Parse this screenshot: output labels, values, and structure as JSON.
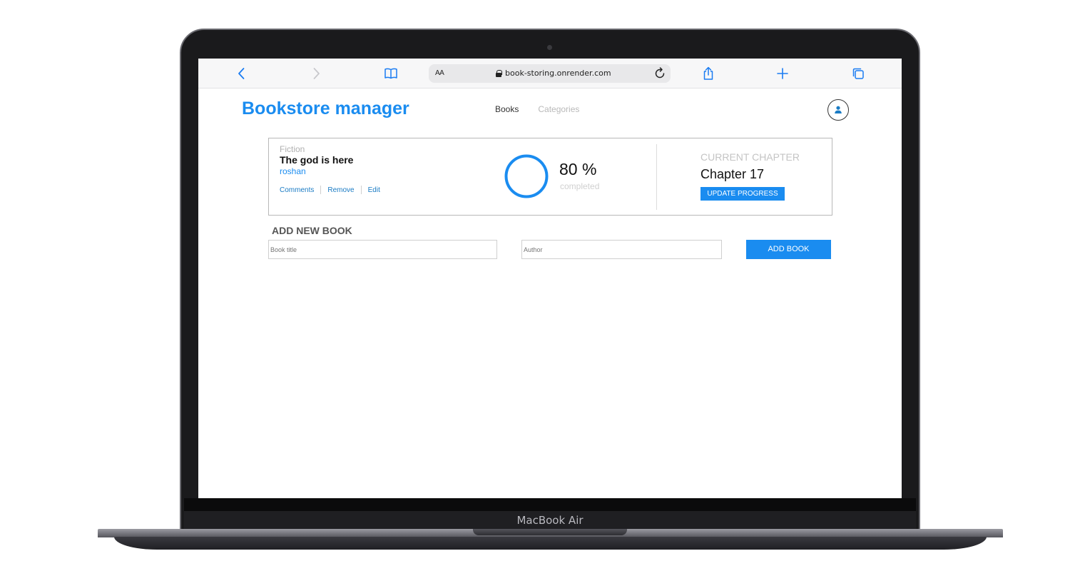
{
  "device": {
    "label": "MacBook Air"
  },
  "browser": {
    "text_size_label": "AA",
    "url": "book-storing.onrender.com"
  },
  "app": {
    "title": "Bookstore manager",
    "nav": {
      "books": "Books",
      "categories": "Categories"
    }
  },
  "book": {
    "genre": "Fiction",
    "title": "The god is here",
    "author": "roshan",
    "actions": {
      "comments": "Comments",
      "remove": "Remove",
      "edit": "Edit"
    },
    "progress_percent": 80,
    "progress_text": "80 %",
    "progress_label": "completed",
    "chapter_label": "CURRENT CHAPTER",
    "chapter": "Chapter 17",
    "update_button": "UPDATE PROGRESS"
  },
  "add_form": {
    "heading": "ADD NEW BOOK",
    "title_placeholder": "Book title",
    "author_placeholder": "Author",
    "submit": "ADD BOOK"
  },
  "colors": {
    "accent": "#1a8cf0",
    "safari_blue": "#1a7cf2"
  }
}
